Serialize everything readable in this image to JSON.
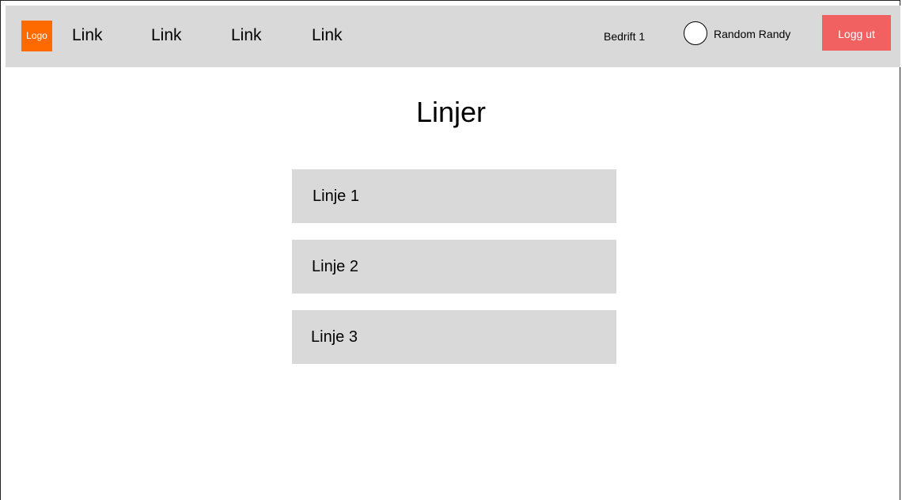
{
  "navbar": {
    "logo_text": "Logo",
    "links": [
      "Link",
      "Link",
      "Link",
      "Link"
    ],
    "company": "Bedrift 1",
    "user_name": "Random Randy",
    "logout_label": "Logg ut"
  },
  "main": {
    "title": "Linjer",
    "lines": [
      "Linje 1",
      "Linje 2",
      "Linje 3"
    ]
  },
  "colors": {
    "navbar_bg": "#d9d9d9",
    "logo_bg": "#ff6a00",
    "logout_bg": "#f26161",
    "line_bg": "#d9d9d9"
  }
}
